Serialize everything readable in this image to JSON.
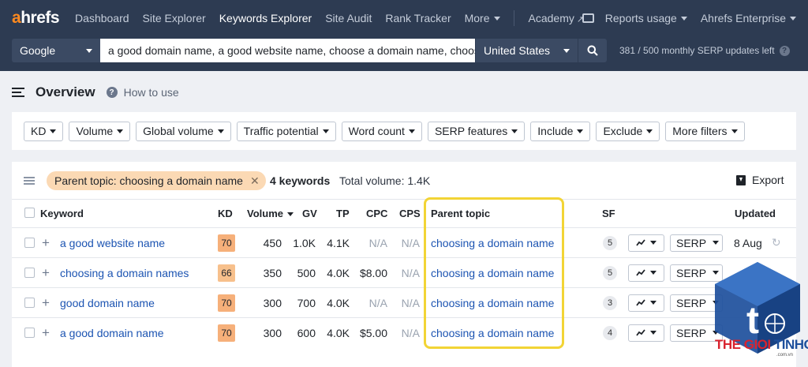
{
  "topnav": {
    "logo_a": "a",
    "logo_rest": "hrefs",
    "items": [
      {
        "label": "Dashboard"
      },
      {
        "label": "Site Explorer"
      },
      {
        "label": "Keywords Explorer",
        "active": true
      },
      {
        "label": "Site Audit"
      },
      {
        "label": "Rank Tracker"
      },
      {
        "label": "More"
      }
    ],
    "academy": "Academy",
    "reports_usage": "Reports usage",
    "account": "Ahrefs Enterprise"
  },
  "searchbar": {
    "engine": "Google",
    "query": "a good domain name, a good website name, choose a domain name, choose a domain",
    "country": "United States",
    "updates_left": "381 / 500 monthly SERP updates left"
  },
  "overview": {
    "title": "Overview",
    "how_to_use": "How to use"
  },
  "filters": [
    "KD",
    "Volume",
    "Global volume",
    "Traffic potential",
    "Word count",
    "SERP features",
    "Include",
    "Exclude",
    "More filters"
  ],
  "table": {
    "parent_topic_chip": "Parent topic: choosing a domain name",
    "keyword_count": "4 keywords",
    "total_volume": "Total volume: 1.4K",
    "export": "Export",
    "headers": {
      "keyword": "Keyword",
      "kd": "KD",
      "volume": "Volume",
      "gv": "GV",
      "tp": "TP",
      "cpc": "CPC",
      "cps": "CPS",
      "parent_topic": "Parent topic",
      "sf": "SF",
      "updated": "Updated"
    },
    "rows": [
      {
        "keyword": "a good website name",
        "kd": "70",
        "volume": "450",
        "gv": "1.0K",
        "tp": "4.1K",
        "cpc": "N/A",
        "cps": "N/A",
        "parent_topic": "choosing a domain name",
        "sf": "5",
        "serp": "SERP",
        "updated": "8 Aug"
      },
      {
        "keyword": "choosing a domain names",
        "kd": "66",
        "volume": "350",
        "gv": "500",
        "tp": "4.0K",
        "cpc": "$8.00",
        "cps": "N/A",
        "parent_topic": "choosing a domain name",
        "sf": "5",
        "serp": "SERP",
        "updated": ""
      },
      {
        "keyword": "good domain name",
        "kd": "70",
        "volume": "300",
        "gv": "700",
        "tp": "4.0K",
        "cpc": "N/A",
        "cps": "N/A",
        "parent_topic": "choosing a domain name",
        "sf": "3",
        "serp": "SERP",
        "updated": ""
      },
      {
        "keyword": "a good domain name",
        "kd": "70",
        "volume": "300",
        "gv": "600",
        "tp": "4.0K",
        "cpc": "$5.00",
        "cps": "N/A",
        "parent_topic": "choosing a domain name",
        "sf": "4",
        "serp": "SERP",
        "updated": ""
      }
    ]
  },
  "colors": {
    "nav_bg": "#2d3b52",
    "brand_orange": "#ff8a1f",
    "link_blue": "#1c54b2",
    "kd_70": "#f6b07a",
    "kd_66": "#f7c08c",
    "chip_bg": "#fbd9b4",
    "highlight": "#f2d435"
  },
  "watermark": {
    "word1": "THE GIOI",
    "word2": "TINHOC",
    "domain": ".com.vn"
  }
}
